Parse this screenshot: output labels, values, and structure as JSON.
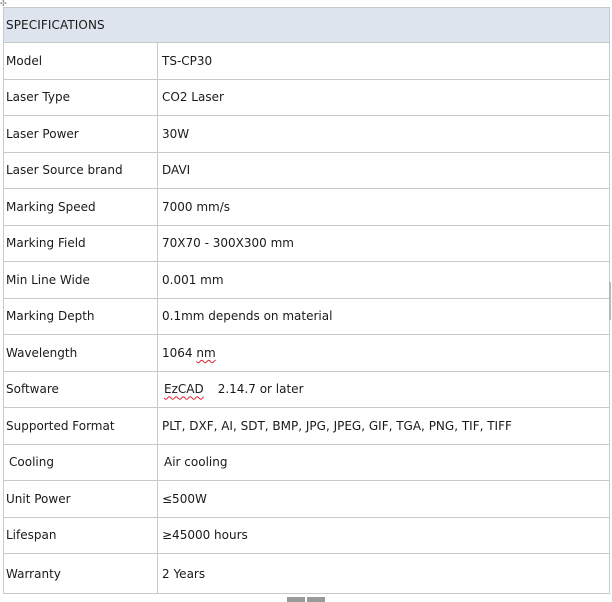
{
  "table": {
    "header": "SPECIFICATIONS",
    "rows": [
      {
        "label": "Model",
        "value": "TS-CP30"
      },
      {
        "label": "Laser Type",
        "value": "CO2 Laser"
      },
      {
        "label": "Laser Power",
        "value": "30W"
      },
      {
        "label": "Laser Source brand",
        "value": "DAVI"
      },
      {
        "label": "Marking Speed",
        "value": "7000 mm/s"
      },
      {
        "label": "Marking Field",
        "value": "70X70 - 300X300 mm"
      },
      {
        "label": "Min Line Wide",
        "value": "0.001 mm"
      },
      {
        "label": "Marking Depth",
        "value": "0.1mm depends on material"
      },
      {
        "label": "Wavelength",
        "value_number": "1064",
        "value_unit": "nm"
      },
      {
        "label": "Software",
        "value_name": "EzCAD",
        "value_version": "2.14.7 or later"
      },
      {
        "label": "Supported Format",
        "value": "PLT, DXF, AI, SDT, BMP, JPG, JPEG, GIF, TGA, PNG, TIF, TIFF"
      },
      {
        "label": "Cooling",
        "value": "Air cooling"
      },
      {
        "label": "Unit Power",
        "value": "≤500W"
      },
      {
        "label": "Lifespan",
        "value": "≥45000 hours"
      },
      {
        "label": "Warranty",
        "value": "2 Years"
      }
    ]
  },
  "colors": {
    "header_background": "#dde4ee",
    "border": "#c9c9c9",
    "spellcheck_underline": "#dd2233"
  }
}
